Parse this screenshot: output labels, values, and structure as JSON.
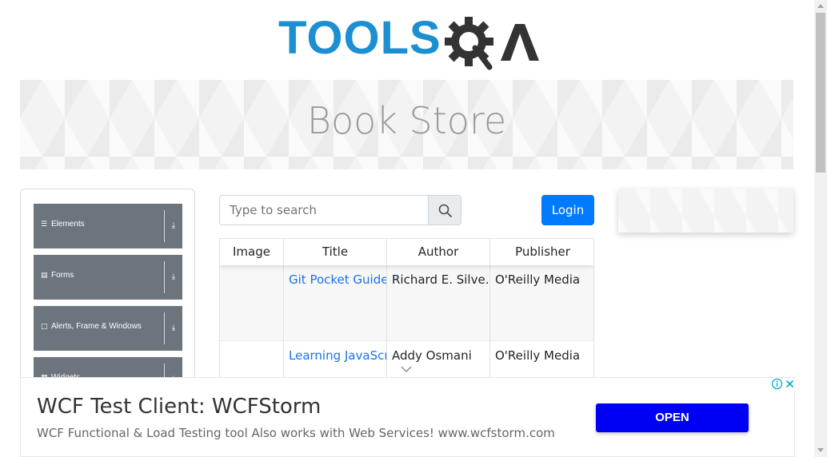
{
  "header": {
    "logo_text": "TOOLSQA"
  },
  "banner": {
    "title": "Book Store"
  },
  "sidebar": {
    "items": [
      {
        "label": "Elements",
        "icon": "hamburger-icon"
      },
      {
        "label": "Forms",
        "icon": "form-icon"
      },
      {
        "label": "Alerts, Frame & Windows",
        "icon": "window-icon"
      },
      {
        "label": "Widgets",
        "icon": "widgets-icon"
      }
    ]
  },
  "search": {
    "placeholder": "Type to search",
    "value": "",
    "icon": "search-icon"
  },
  "login": {
    "label": "Login"
  },
  "table": {
    "columns": [
      "Image",
      "Title",
      "Author",
      "Publisher"
    ],
    "rows": [
      {
        "image": "",
        "title": "Git Pocket Guide",
        "author": "Richard E. Silve...",
        "publisher": "O'Reilly Media"
      },
      {
        "image": "",
        "title": "Learning JavaScript Design Patterns",
        "author": "Addy Osmani",
        "publisher": "O'Reilly Media"
      }
    ]
  },
  "ad": {
    "headline": "WCF Test Client: WCFStorm",
    "description": "WCF Functional & Load Testing tool Also works with Web Services! www.wcfstorm.com",
    "cta": "OPEN",
    "cta_color": "#0000f5"
  },
  "colors": {
    "brand_blue": "#1b8fd2",
    "brand_dark": "#333333",
    "sidebar_item_bg": "#6c757d",
    "login_bg": "#007bff",
    "link": "#1a73e8"
  }
}
